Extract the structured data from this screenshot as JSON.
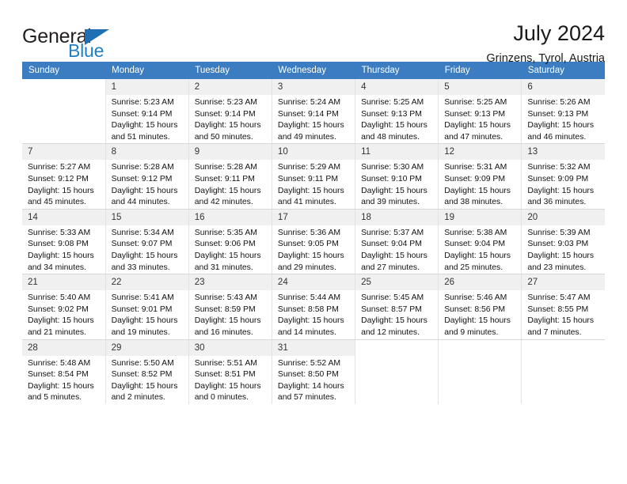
{
  "brand": {
    "name_top": "General",
    "name_bottom": "Blue",
    "triangle_color": "#1f6fb4",
    "blue_color": "#1f7fc4"
  },
  "header": {
    "title": "July 2024",
    "location": "Grinzens, Tyrol, Austria"
  },
  "theme": {
    "header_bg": "#3b7dc0",
    "daynum_bg": "#f0f0f0",
    "grid_line": "#e3e3e3"
  },
  "calendar": {
    "weekday_headers": [
      "Sunday",
      "Monday",
      "Tuesday",
      "Wednesday",
      "Thursday",
      "Friday",
      "Saturday"
    ],
    "weeks": [
      [
        {
          "day": "",
          "lines": []
        },
        {
          "day": "1",
          "lines": [
            "Sunrise: 5:23 AM",
            "Sunset: 9:14 PM",
            "Daylight: 15 hours",
            "and 51 minutes."
          ]
        },
        {
          "day": "2",
          "lines": [
            "Sunrise: 5:23 AM",
            "Sunset: 9:14 PM",
            "Daylight: 15 hours",
            "and 50 minutes."
          ]
        },
        {
          "day": "3",
          "lines": [
            "Sunrise: 5:24 AM",
            "Sunset: 9:14 PM",
            "Daylight: 15 hours",
            "and 49 minutes."
          ]
        },
        {
          "day": "4",
          "lines": [
            "Sunrise: 5:25 AM",
            "Sunset: 9:13 PM",
            "Daylight: 15 hours",
            "and 48 minutes."
          ]
        },
        {
          "day": "5",
          "lines": [
            "Sunrise: 5:25 AM",
            "Sunset: 9:13 PM",
            "Daylight: 15 hours",
            "and 47 minutes."
          ]
        },
        {
          "day": "6",
          "lines": [
            "Sunrise: 5:26 AM",
            "Sunset: 9:13 PM",
            "Daylight: 15 hours",
            "and 46 minutes."
          ]
        }
      ],
      [
        {
          "day": "7",
          "lines": [
            "Sunrise: 5:27 AM",
            "Sunset: 9:12 PM",
            "Daylight: 15 hours",
            "and 45 minutes."
          ]
        },
        {
          "day": "8",
          "lines": [
            "Sunrise: 5:28 AM",
            "Sunset: 9:12 PM",
            "Daylight: 15 hours",
            "and 44 minutes."
          ]
        },
        {
          "day": "9",
          "lines": [
            "Sunrise: 5:28 AM",
            "Sunset: 9:11 PM",
            "Daylight: 15 hours",
            "and 42 minutes."
          ]
        },
        {
          "day": "10",
          "lines": [
            "Sunrise: 5:29 AM",
            "Sunset: 9:11 PM",
            "Daylight: 15 hours",
            "and 41 minutes."
          ]
        },
        {
          "day": "11",
          "lines": [
            "Sunrise: 5:30 AM",
            "Sunset: 9:10 PM",
            "Daylight: 15 hours",
            "and 39 minutes."
          ]
        },
        {
          "day": "12",
          "lines": [
            "Sunrise: 5:31 AM",
            "Sunset: 9:09 PM",
            "Daylight: 15 hours",
            "and 38 minutes."
          ]
        },
        {
          "day": "13",
          "lines": [
            "Sunrise: 5:32 AM",
            "Sunset: 9:09 PM",
            "Daylight: 15 hours",
            "and 36 minutes."
          ]
        }
      ],
      [
        {
          "day": "14",
          "lines": [
            "Sunrise: 5:33 AM",
            "Sunset: 9:08 PM",
            "Daylight: 15 hours",
            "and 34 minutes."
          ]
        },
        {
          "day": "15",
          "lines": [
            "Sunrise: 5:34 AM",
            "Sunset: 9:07 PM",
            "Daylight: 15 hours",
            "and 33 minutes."
          ]
        },
        {
          "day": "16",
          "lines": [
            "Sunrise: 5:35 AM",
            "Sunset: 9:06 PM",
            "Daylight: 15 hours",
            "and 31 minutes."
          ]
        },
        {
          "day": "17",
          "lines": [
            "Sunrise: 5:36 AM",
            "Sunset: 9:05 PM",
            "Daylight: 15 hours",
            "and 29 minutes."
          ]
        },
        {
          "day": "18",
          "lines": [
            "Sunrise: 5:37 AM",
            "Sunset: 9:04 PM",
            "Daylight: 15 hours",
            "and 27 minutes."
          ]
        },
        {
          "day": "19",
          "lines": [
            "Sunrise: 5:38 AM",
            "Sunset: 9:04 PM",
            "Daylight: 15 hours",
            "and 25 minutes."
          ]
        },
        {
          "day": "20",
          "lines": [
            "Sunrise: 5:39 AM",
            "Sunset: 9:03 PM",
            "Daylight: 15 hours",
            "and 23 minutes."
          ]
        }
      ],
      [
        {
          "day": "21",
          "lines": [
            "Sunrise: 5:40 AM",
            "Sunset: 9:02 PM",
            "Daylight: 15 hours",
            "and 21 minutes."
          ]
        },
        {
          "day": "22",
          "lines": [
            "Sunrise: 5:41 AM",
            "Sunset: 9:01 PM",
            "Daylight: 15 hours",
            "and 19 minutes."
          ]
        },
        {
          "day": "23",
          "lines": [
            "Sunrise: 5:43 AM",
            "Sunset: 8:59 PM",
            "Daylight: 15 hours",
            "and 16 minutes."
          ]
        },
        {
          "day": "24",
          "lines": [
            "Sunrise: 5:44 AM",
            "Sunset: 8:58 PM",
            "Daylight: 15 hours",
            "and 14 minutes."
          ]
        },
        {
          "day": "25",
          "lines": [
            "Sunrise: 5:45 AM",
            "Sunset: 8:57 PM",
            "Daylight: 15 hours",
            "and 12 minutes."
          ]
        },
        {
          "day": "26",
          "lines": [
            "Sunrise: 5:46 AM",
            "Sunset: 8:56 PM",
            "Daylight: 15 hours",
            "and 9 minutes."
          ]
        },
        {
          "day": "27",
          "lines": [
            "Sunrise: 5:47 AM",
            "Sunset: 8:55 PM",
            "Daylight: 15 hours",
            "and 7 minutes."
          ]
        }
      ],
      [
        {
          "day": "28",
          "lines": [
            "Sunrise: 5:48 AM",
            "Sunset: 8:54 PM",
            "Daylight: 15 hours",
            "and 5 minutes."
          ]
        },
        {
          "day": "29",
          "lines": [
            "Sunrise: 5:50 AM",
            "Sunset: 8:52 PM",
            "Daylight: 15 hours",
            "and 2 minutes."
          ]
        },
        {
          "day": "30",
          "lines": [
            "Sunrise: 5:51 AM",
            "Sunset: 8:51 PM",
            "Daylight: 15 hours",
            "and 0 minutes."
          ]
        },
        {
          "day": "31",
          "lines": [
            "Sunrise: 5:52 AM",
            "Sunset: 8:50 PM",
            "Daylight: 14 hours",
            "and 57 minutes."
          ]
        },
        {
          "day": "",
          "lines": []
        },
        {
          "day": "",
          "lines": []
        },
        {
          "day": "",
          "lines": []
        }
      ]
    ]
  }
}
